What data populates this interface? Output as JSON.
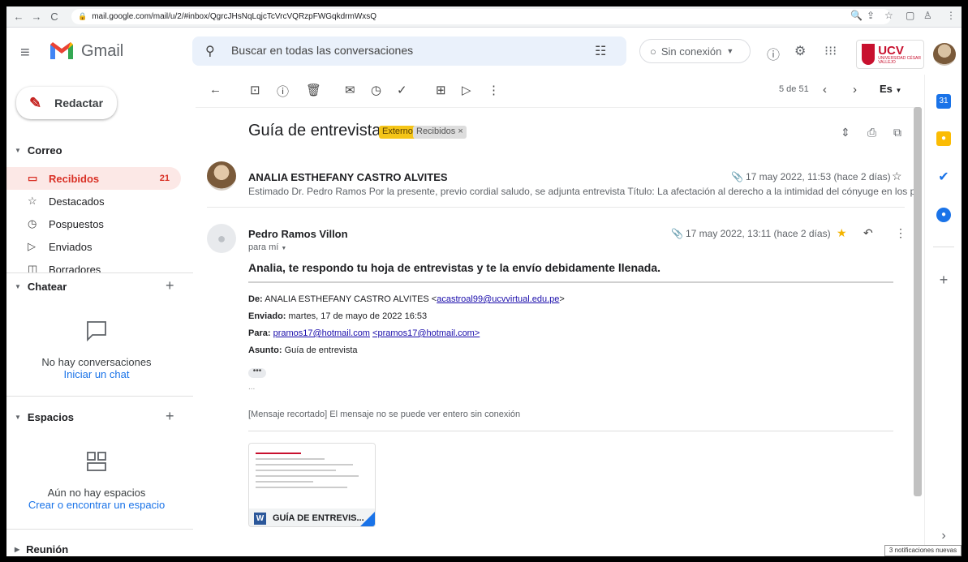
{
  "browser": {
    "url": "mail.google.com/mail/u/2/#inbox/QgrcJHsNqLqjcTcVrcVQRzpFWGqkdrmWxsQ"
  },
  "header": {
    "brand": "Gmail",
    "search_placeholder": "Buscar en todas las conversaciones",
    "offline_label": "Sin conexión",
    "org_logo": {
      "name": "UCV",
      "subtitle": "UNIVERSIDAD CÉSAR VALLEJO"
    }
  },
  "sidebar": {
    "compose_label": "Redactar",
    "mail_section": "Correo",
    "items": [
      {
        "label": "Recibidos",
        "count": "21",
        "icon": "inbox-icon"
      },
      {
        "label": "Destacados",
        "icon": "star-icon"
      },
      {
        "label": "Pospuestos",
        "icon": "clock-icon"
      },
      {
        "label": "Enviados",
        "icon": "send-icon"
      },
      {
        "label": "Borradores",
        "icon": "draft-icon"
      }
    ],
    "chat_section": "Chatear",
    "chat_empty": "No hay conversaciones",
    "chat_link": "Iniciar un chat",
    "spaces_section": "Espacios",
    "spaces_empty": "Aún no hay espacios",
    "spaces_link": "Crear o encontrar un espacio",
    "meet_section": "Reunión"
  },
  "toolbar": {
    "pager": "5 de 51",
    "language": "Es"
  },
  "thread": {
    "subject": "Guía de entrevista",
    "labels": [
      "Externo",
      "Recibidos ×"
    ],
    "messages": [
      {
        "sender": "ANALIA ESTHEFANY CASTRO ALVITES",
        "date": "17 may 2022, 11:53 (hace 2 días)",
        "snippet": "Estimado Dr. Pedro Ramos Por la presente, previo cordial saludo, se adjunta entrevista Título: La afectación al derecho a la intimidad del cónyuge en los proces"
      },
      {
        "sender": "Pedro Ramos Villon",
        "date": "17 may 2022, 13:11 (hace 2 días)",
        "to": "para mí",
        "body_title": "Analia, te respondo tu hoja de entrevistas y te la envío debidamente llenada.",
        "quoted": {
          "from_label": "De:",
          "from_value": "ANALIA ESTHEFANY CASTRO ALVITES <",
          "from_email": "acastroal99@ucvvirtual.edu.pe",
          "from_close": ">",
          "sent_label": "Enviado:",
          "sent_value": "martes, 17 de mayo de 2022 16:53",
          "to_label": "Para:",
          "to_email": "pramos17@hotmail.com",
          "to_email_2": "<pramos17@hotmail.com>",
          "subject_label": "Asunto:",
          "subject_value": "Guía de entrevista"
        },
        "ellipsis": "•••",
        "clipped_link": "[Mensaje recortado]",
        "clipped_text": "El mensaje no se puede ver entero sin conexión",
        "attachment": {
          "name": "GUÍA DE ENTREVIS...",
          "type_badge": "W"
        }
      }
    ]
  },
  "notification": "3 notificaciones nuevas"
}
